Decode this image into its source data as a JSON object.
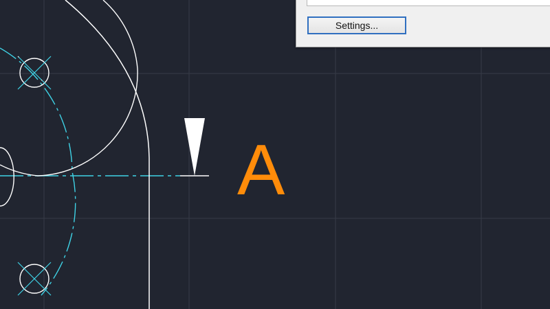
{
  "dialog": {
    "settings_button_label": "Settings..."
  },
  "drawing": {
    "section_label": "A",
    "colors": {
      "background": "#212530",
      "grid": "#363b47",
      "geometry": "#ffffff",
      "centerline": "#3fd3e6",
      "label": "#ff8c0a"
    },
    "icons": [
      "section-arrow-icon",
      "center-mark-icon"
    ]
  }
}
